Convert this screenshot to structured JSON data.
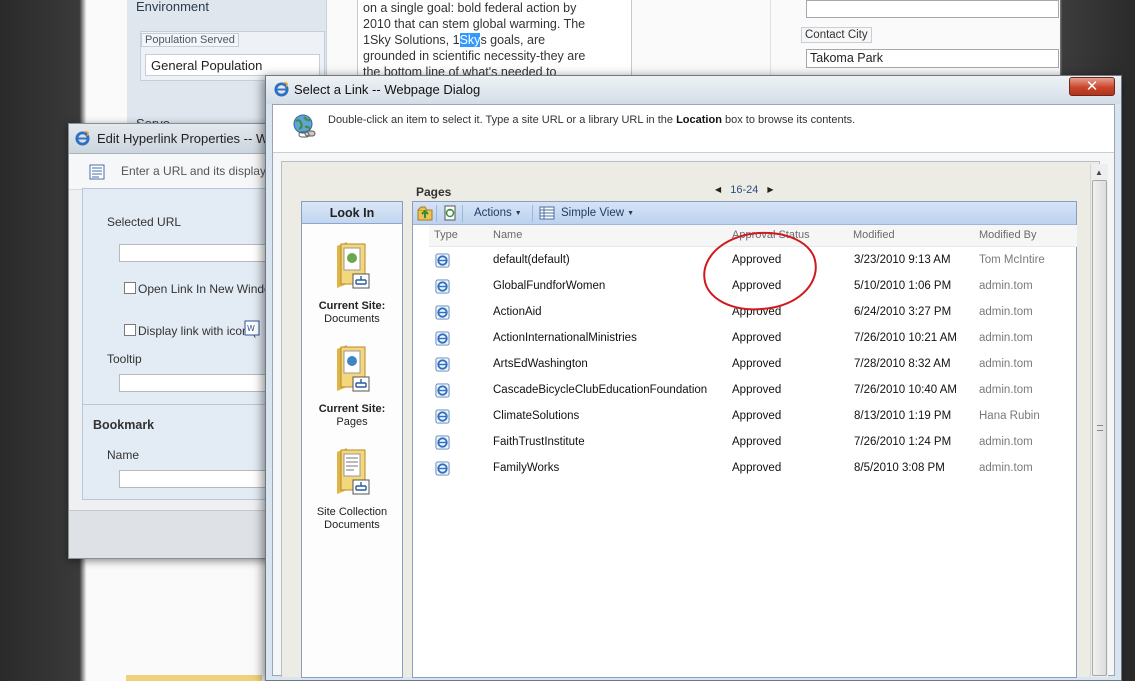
{
  "background": {
    "section_heading": "Environment",
    "population_label": "Population Served",
    "population_value": "General Population",
    "partial_heading": "Servo",
    "article_lines": [
      "on a single goal: bold federal action by",
      "2010 that can stem global warming. The",
      "1Sky Solutions, 1",
      "grounded in scientific necessity-they are",
      "the bottom line of what's needed to"
    ],
    "article_highlight": "Sky",
    "article_line3_tail": "s goals, are",
    "contact_city_label": "Contact City",
    "contact_city_value": "Takoma Park"
  },
  "edit_dialog": {
    "title": "Edit Hyperlink Properties -- Webpage Dialog",
    "hint": "Enter a URL and its display properties",
    "selected_url_label": "Selected URL",
    "open_new_window_label": "Open Link In New Window",
    "display_icon_label": "Display link with icon (",
    "tooltip_label": "Tooltip",
    "bookmark_heading": "Bookmark",
    "name_label": "Name"
  },
  "select_dialog": {
    "title": "Select a Link -- Webpage Dialog",
    "close_label": "✕",
    "instruction_before": "Double-click an item to select it. Type a site URL or a library URL in the ",
    "instruction_bold": "Location",
    "instruction_after": " box to browse its contents.",
    "pages_heading": "Pages",
    "pager": {
      "prev": "◀",
      "range": "16-24",
      "next": "▶"
    },
    "look_in": {
      "heading": "Look In",
      "items": [
        {
          "line1": "Current Site:",
          "line2": "Documents"
        },
        {
          "line1": "Current Site:",
          "line2": "Pages"
        },
        {
          "line1": "Site Collection",
          "line2": "Documents"
        }
      ]
    },
    "toolbar": {
      "actions_label": "Actions",
      "view_label": "Simple View"
    },
    "columns": [
      "Type",
      "Name",
      "Approval Status",
      "Modified",
      "Modified By"
    ],
    "rows": [
      {
        "name": "default(default)",
        "status": "Approved",
        "modified": "3/23/2010 9:13 AM",
        "by": "Tom McIntire"
      },
      {
        "name": "GlobalFundforWomen",
        "status": "Approved",
        "modified": "5/10/2010 1:06 PM",
        "by": "admin.tom"
      },
      {
        "name": "ActionAid",
        "status": "Approved",
        "modified": "6/24/2010 3:27 PM",
        "by": "admin.tom"
      },
      {
        "name": "ActionInternationalMinistries",
        "status": "Approved",
        "modified": "7/26/2010 10:21 AM",
        "by": "admin.tom"
      },
      {
        "name": "ArtsEdWashington",
        "status": "Approved",
        "modified": "7/28/2010 8:32 AM",
        "by": "admin.tom"
      },
      {
        "name": "CascadeBicycleClubEducationFoundation",
        "status": "Approved",
        "modified": "7/26/2010 10:40 AM",
        "by": "admin.tom"
      },
      {
        "name": "ClimateSolutions",
        "status": "Approved",
        "modified": "8/13/2010 1:19 PM",
        "by": "Hana Rubin"
      },
      {
        "name": "FaithTrustInstitute",
        "status": "Approved",
        "modified": "7/26/2010 1:24 PM",
        "by": "admin.tom"
      },
      {
        "name": "FamilyWorks",
        "status": "Approved",
        "modified": "8/5/2010 3:08 PM",
        "by": "admin.tom"
      }
    ],
    "icons": [
      "ie-page-icon",
      "folder-icon",
      "globe-link-icon",
      "up-folder-icon",
      "new-item-icon",
      "view-grid-icon"
    ],
    "colors": {
      "annotation_red": "#d0191e",
      "toolbar_blue": "#bdd2ee",
      "close_red": "#c9462c"
    }
  }
}
